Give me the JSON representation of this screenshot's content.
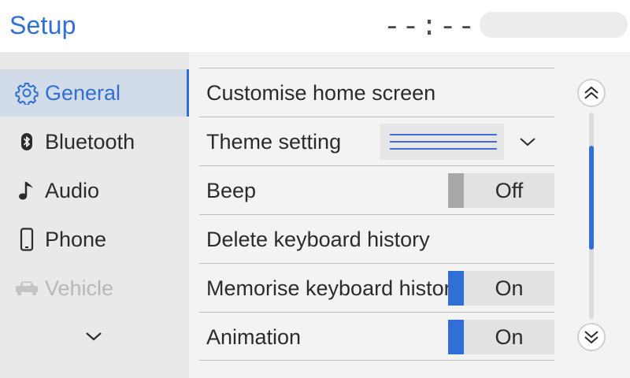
{
  "header": {
    "title": "Setup",
    "clock": "--:--"
  },
  "colors": {
    "accent": "#2f6fd6",
    "toggle_on": "#2f6fd6",
    "toggle_off": "#a8a8a8"
  },
  "sidebar": {
    "items": [
      {
        "label": "General",
        "icon": "gear-icon",
        "state": "active"
      },
      {
        "label": "Bluetooth",
        "icon": "bluetooth-icon",
        "state": "normal"
      },
      {
        "label": "Audio",
        "icon": "music-note-icon",
        "state": "normal"
      },
      {
        "label": "Phone",
        "icon": "phone-icon",
        "state": "normal"
      },
      {
        "label": "Vehicle",
        "icon": "car-icon",
        "state": "disabled"
      }
    ],
    "more_icon": "chevron-down-icon"
  },
  "settings": {
    "rows": [
      {
        "label": "Customise home screen"
      },
      {
        "label": "Theme setting",
        "control": "theme-dropdown"
      },
      {
        "label": "Beep",
        "control": "toggle",
        "value": "Off",
        "on": false
      },
      {
        "label": "Delete keyboard history"
      },
      {
        "label": "Memorise keyboard history",
        "control": "toggle",
        "value": "On",
        "on": true
      },
      {
        "label": "Animation",
        "control": "toggle",
        "value": "On",
        "on": true
      }
    ]
  },
  "scroll": {
    "up_icon": "double-chevron-up-icon",
    "down_icon": "double-chevron-down-icon"
  }
}
